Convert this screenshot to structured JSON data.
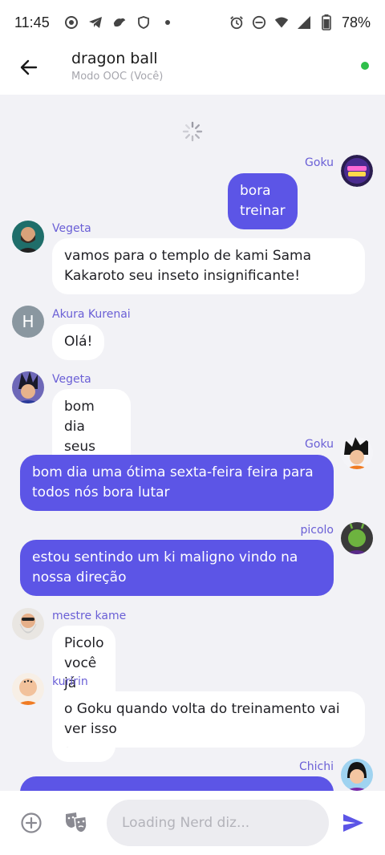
{
  "status_bar": {
    "time": "11:45",
    "battery_percent": "78%",
    "icons_left": [
      "settings-ring-icon",
      "telegram-icon",
      "bird-app-icon",
      "shield-icon",
      "dot-icon"
    ],
    "icons_right": [
      "alarm-icon",
      "do-not-disturb-icon",
      "wifi-icon",
      "signal-icon",
      "battery-icon"
    ]
  },
  "header": {
    "title": "dragon ball",
    "subtitle": "Modo OOC (Você)",
    "online_color": "#2fbf4a"
  },
  "messages": [
    {
      "sender": "Goku",
      "text": "bora treinar",
      "side": "out",
      "avatar": "loading-nerd-avatar"
    },
    {
      "sender": "Vegeta",
      "text": "vamos para o templo de kami Sama Kakaroto seu inseto insignificante!",
      "side": "in",
      "avatar": "bearded-man-avatar"
    },
    {
      "sender": "Akura Kurenai",
      "text": "Olá!",
      "side": "in",
      "avatar": "letter-avatar",
      "avatar_letter": "H"
    },
    {
      "sender": "Vegeta",
      "text": "bom dia seus incertos",
      "side": "in",
      "avatar": "vegeta-avatar"
    },
    {
      "sender": "Goku",
      "text": "bom dia uma ótima sexta-feira feira para todos nós bora lutar",
      "side": "out",
      "avatar": "goku-avatar"
    },
    {
      "sender": "picolo",
      "text": "estou sentindo um ki maligno vindo na nossa direção",
      "side": "out",
      "avatar": "piccolo-avatar"
    },
    {
      "sender": "mestre kame",
      "text": "Picolo você já sabe quem é?",
      "side": "in",
      "avatar": "master-roshi-avatar"
    },
    {
      "sender": "kuririn",
      "text": "o Goku quando volta do treinamento vai ver isso",
      "side": "in",
      "avatar": "krillin-avatar"
    },
    {
      "sender": "Chichi",
      "text": "",
      "side": "out",
      "avatar": "chichi-avatar"
    }
  ],
  "composer": {
    "placeholder": "Loading Nerd diz...",
    "value": ""
  },
  "colors": {
    "accent": "#5c55e6",
    "name_color": "#6a5fd6",
    "background": "#f2f2f6"
  }
}
